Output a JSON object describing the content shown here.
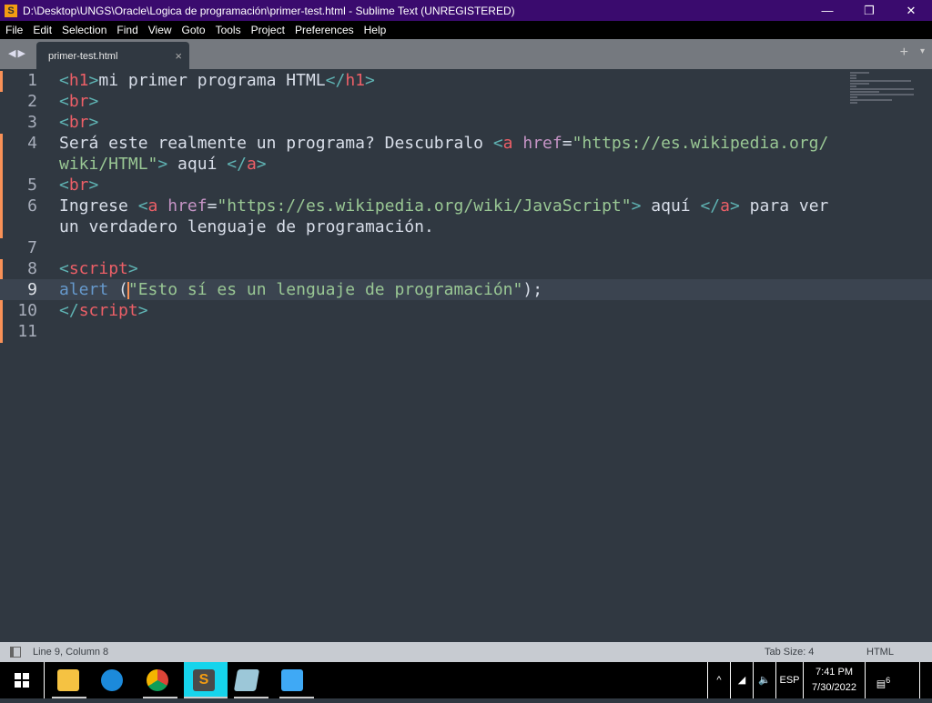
{
  "window": {
    "title": "D:\\Desktop\\UNGS\\Oracle\\Logica de programación\\primer-test.html - Sublime Text (UNREGISTERED)",
    "minimize": "—",
    "maximize": "❐",
    "close": "✕"
  },
  "menu": [
    "File",
    "Edit",
    "Selection",
    "Find",
    "View",
    "Goto",
    "Tools",
    "Project",
    "Preferences",
    "Help"
  ],
  "tabs": [
    {
      "label": "primer-test.html",
      "close": "×"
    }
  ],
  "tabbar": {
    "nav": "◀▶",
    "add": "+",
    "menu": "▾"
  },
  "colors": {
    "tag": "#ec5f67",
    "bracket": "#5fb3b3",
    "attr": "#c594c5",
    "string": "#99c794",
    "text": "#d8dee9",
    "modified": "#f99157"
  },
  "code": [
    {
      "n": "1",
      "tokens": [
        [
          "br",
          "<"
        ],
        [
          "tag",
          "h1"
        ],
        [
          "br",
          ">"
        ],
        [
          "txt",
          "mi primer programa HTML"
        ],
        [
          "br",
          "</"
        ],
        [
          "tag",
          "h1"
        ],
        [
          "br",
          ">"
        ]
      ]
    },
    {
      "n": "2",
      "tokens": [
        [
          "br",
          "<"
        ],
        [
          "tag",
          "br"
        ],
        [
          "br",
          ">"
        ]
      ]
    },
    {
      "n": "3",
      "tokens": [
        [
          "br",
          "<"
        ],
        [
          "tag",
          "br"
        ],
        [
          "br",
          ">"
        ]
      ]
    },
    {
      "n": "4",
      "tokens": [
        [
          "txt",
          "Será este realmente un programa? Descubralo "
        ],
        [
          "br",
          "<"
        ],
        [
          "tag",
          "a"
        ],
        [
          "txt",
          " "
        ],
        [
          "attr",
          "href"
        ],
        [
          "txt",
          "="
        ],
        [
          "str",
          "\"https://es.wikipedia.org/"
        ]
      ]
    },
    {
      "n": "",
      "tokens": [
        [
          "str",
          "wiki/HTML\""
        ],
        [
          "br",
          ">"
        ],
        [
          "txt",
          " aquí "
        ],
        [
          "br",
          "</"
        ],
        [
          "tag",
          "a"
        ],
        [
          "br",
          ">"
        ]
      ]
    },
    {
      "n": "5",
      "tokens": [
        [
          "br",
          "<"
        ],
        [
          "tag",
          "br"
        ],
        [
          "br",
          ">"
        ]
      ]
    },
    {
      "n": "6",
      "tokens": [
        [
          "txt",
          "Ingrese "
        ],
        [
          "br",
          "<"
        ],
        [
          "tag",
          "a"
        ],
        [
          "txt",
          " "
        ],
        [
          "attr",
          "href"
        ],
        [
          "txt",
          "="
        ],
        [
          "str",
          "\"https://es.wikipedia.org/wiki/JavaScript\""
        ],
        [
          "br",
          ">"
        ],
        [
          "txt",
          " aquí "
        ],
        [
          "br",
          "</"
        ],
        [
          "tag",
          "a"
        ],
        [
          "br",
          ">"
        ],
        [
          "txt",
          " para ver"
        ]
      ]
    },
    {
      "n": "",
      "tokens": [
        [
          "txt",
          "un verdadero lenguaje de programación."
        ]
      ]
    },
    {
      "n": "7",
      "tokens": []
    },
    {
      "n": "8",
      "tokens": [
        [
          "br",
          "<"
        ],
        [
          "tag",
          "script"
        ],
        [
          "br",
          ">"
        ]
      ]
    },
    {
      "n": "9",
      "tokens": [
        [
          "fn",
          "alert"
        ],
        [
          "txt",
          " ("
        ],
        [
          "caret",
          ""
        ],
        [
          "str",
          "\"Esto sí es un lenguaje de programación\""
        ],
        [
          "txt",
          ");"
        ]
      ]
    },
    {
      "n": "10",
      "tokens": [
        [
          "br",
          "</"
        ],
        [
          "tag",
          "script"
        ],
        [
          "br",
          ">"
        ]
      ]
    },
    {
      "n": "11",
      "tokens": []
    }
  ],
  "status": {
    "position": "Line 9, Column 8",
    "tab_size": "Tab Size: 4",
    "syntax": "HTML"
  },
  "taskbar": {
    "apps": [
      "file-explorer",
      "edge",
      "chrome",
      "sublime-text",
      "notepad",
      "magnifier"
    ],
    "chevron": "^",
    "language": "ESP",
    "time": "7:41 PM",
    "date": "7/30/2022",
    "notifications": "6"
  }
}
